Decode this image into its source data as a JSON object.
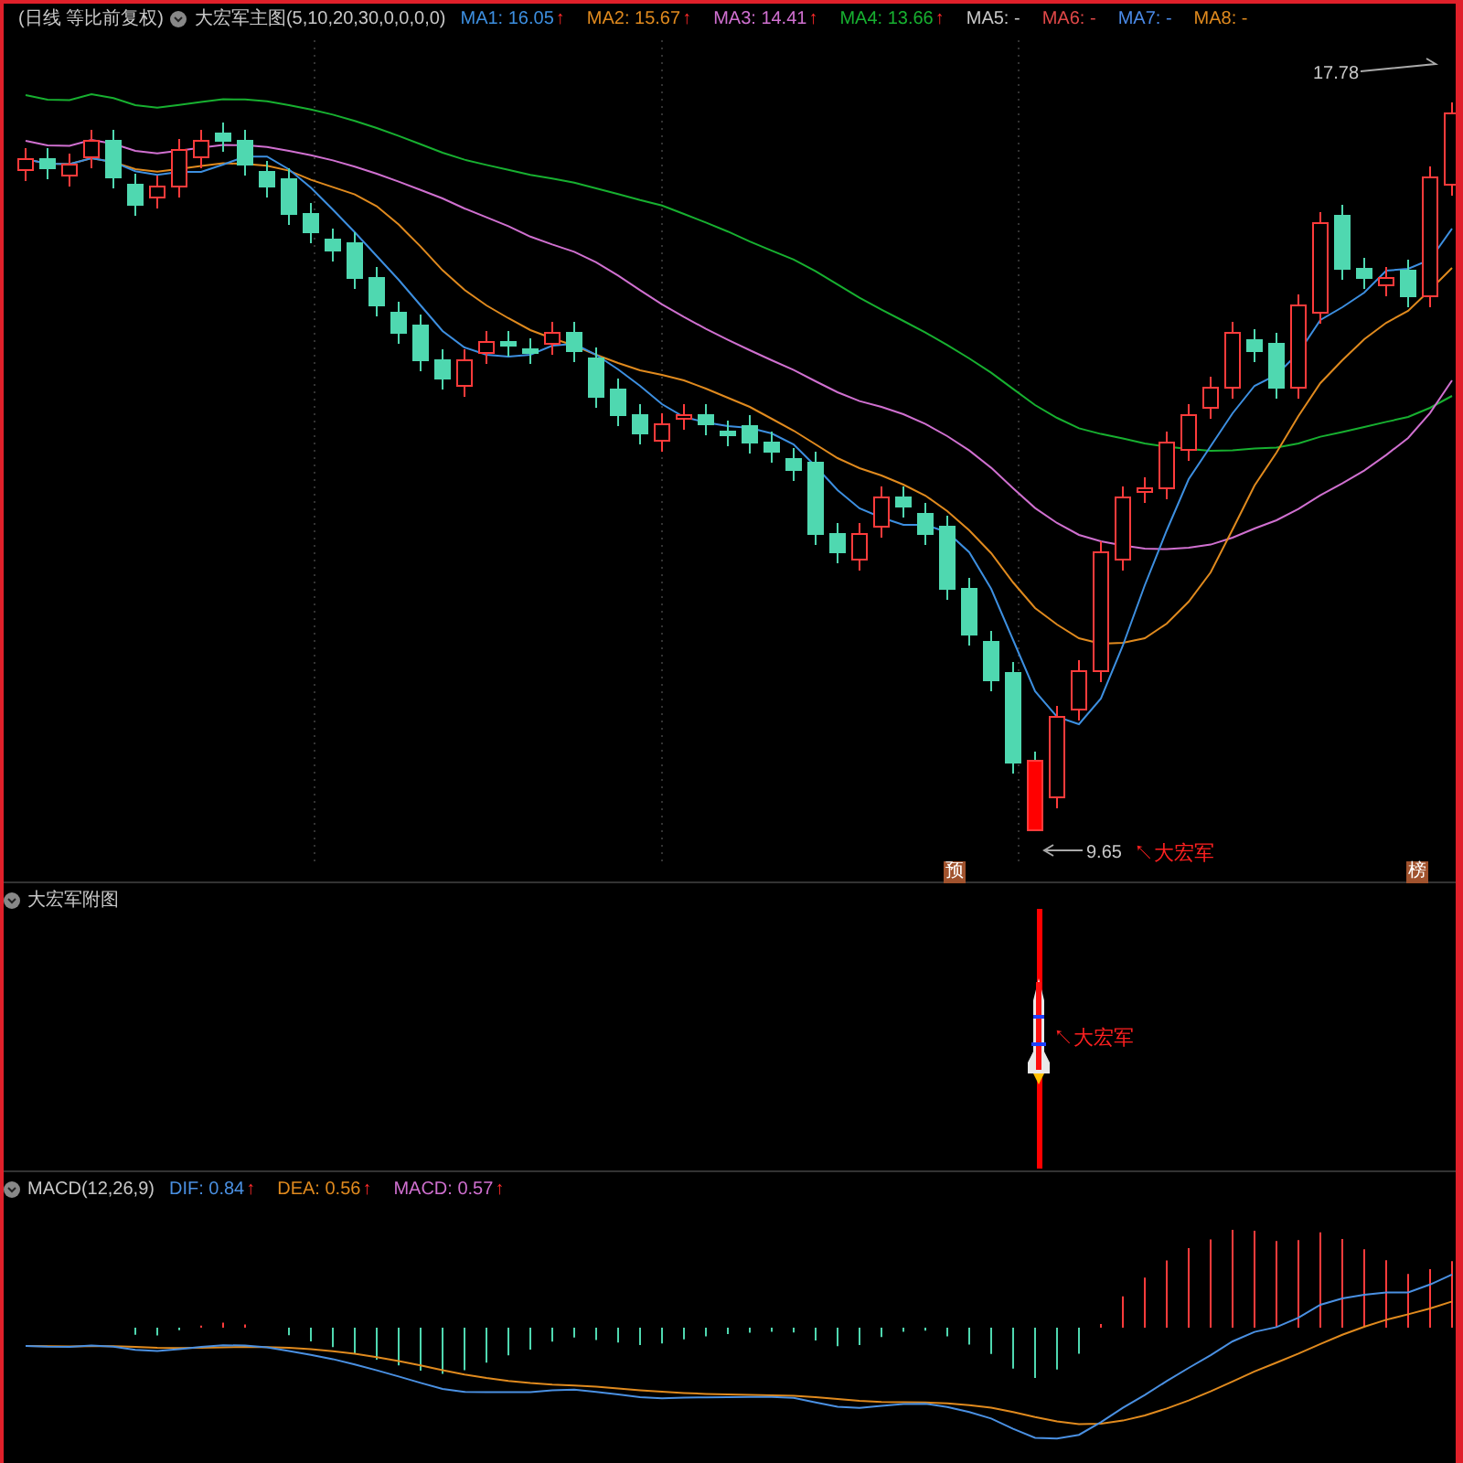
{
  "main_chart": {
    "period": "(日线 等比前复权)",
    "indicator": "大宏军主图(5,10,20,30,0,0,0,0)",
    "averages": [
      {
        "label": "MA1:",
        "value": "16.05",
        "arrow": "↑",
        "color": "#3d8fe0"
      },
      {
        "label": "MA2:",
        "value": "15.67",
        "arrow": "↑",
        "color": "#e08a1e"
      },
      {
        "label": "MA3:",
        "value": "14.41",
        "arrow": "↑",
        "color": "#d070d0"
      },
      {
        "label": "MA4:",
        "value": "13.66",
        "arrow": "↑",
        "color": "#17b030"
      },
      {
        "label": "MA5:",
        "value": "-",
        "color": "#c8c8c8"
      },
      {
        "label": "MA6:",
        "value": "-",
        "color": "#e04848"
      },
      {
        "label": "MA7:",
        "value": "-",
        "color": "#4a8ae8"
      },
      {
        "label": "MA8:",
        "value": "-",
        "color": "#e08a1e"
      }
    ],
    "high_label": "17.78",
    "low_label": "9.65",
    "signal_label": "↖大宏军",
    "badges": [
      "预",
      "榜"
    ]
  },
  "sub_chart": {
    "title": "大宏军附图",
    "signal_label": "↖大宏军"
  },
  "macd_chart": {
    "title": "MACD(12,26,9)",
    "values": [
      {
        "label": "DIF:",
        "value": "0.84",
        "arrow": "↑",
        "color": "#4a90e2"
      },
      {
        "label": "DEA:",
        "value": "0.56",
        "arrow": "↑",
        "color": "#e08a1e"
      },
      {
        "label": "MACD:",
        "value": "0.57",
        "arrow": "↑",
        "color": "#d070d0"
      }
    ]
  }
}
